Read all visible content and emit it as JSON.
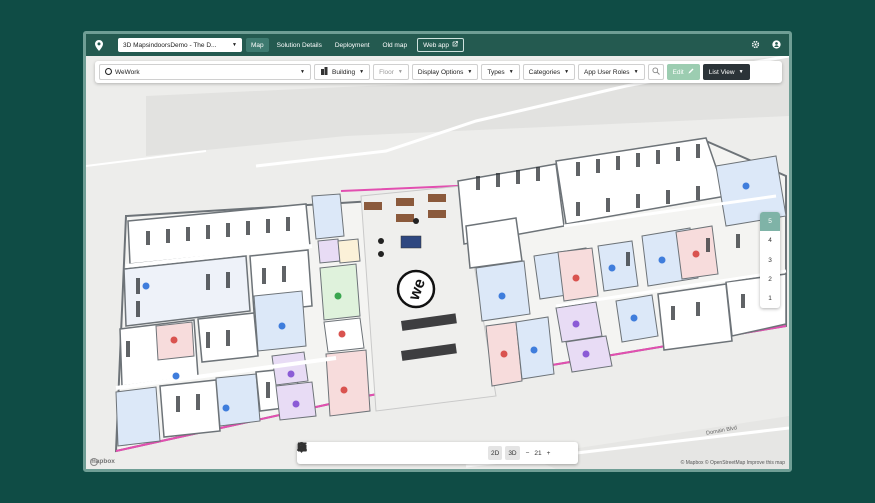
{
  "topbar": {
    "solution": "3D MapsindoorsDemo - The D...",
    "tabs": [
      {
        "label": "Map",
        "active": true
      },
      {
        "label": "Solution Details"
      },
      {
        "label": "Deployment"
      },
      {
        "label": "Old map"
      }
    ],
    "web_app": "Web app"
  },
  "toolbar": {
    "venue": "WeWork",
    "building": "Building",
    "floor": "Floor",
    "display_options": "Display Options",
    "types": "Types",
    "categories": "Categories",
    "app_user_roles": "App User Roles",
    "edit": "Edit",
    "list_view": "List View"
  },
  "floor_selector": {
    "floors": [
      "5",
      "4",
      "3",
      "2",
      "1"
    ],
    "active": "5"
  },
  "bottom_toolbar": {
    "mode_2d": "2D",
    "mode_3d": "3D",
    "zoom_minus": "−",
    "zoom_level": "21",
    "zoom_plus": "+"
  },
  "map": {
    "logo_text": "mapbox",
    "attribution": "© Mapbox © OpenStreetMap  Improve this map",
    "street_label": "Domain Blvd",
    "brand_mark": "we",
    "colors": {
      "room_blue": "#dce8f8",
      "room_pink": "#f7dcdc",
      "room_purple": "#e8dcf5",
      "room_green": "#dff2dc",
      "room_yellow": "#fbf1d8",
      "wall": "#6d7378",
      "building_outline": "#e24fb0"
    }
  }
}
